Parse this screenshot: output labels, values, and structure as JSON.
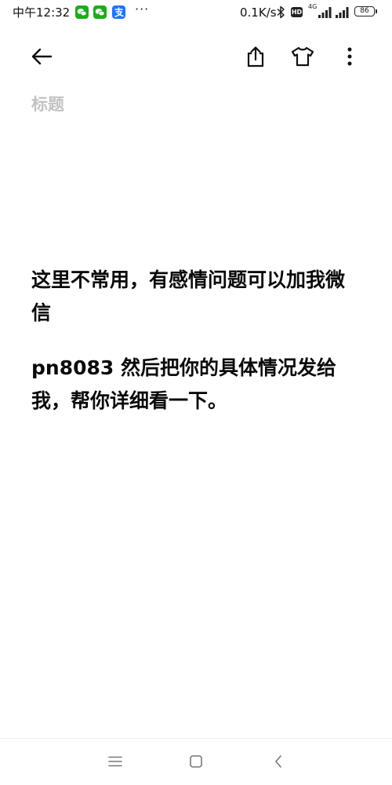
{
  "status_bar": {
    "time": "中午12:32",
    "more_notifications": "···",
    "net_speed": "0.1K/s",
    "hd_label": "HD",
    "network_type": "4G",
    "battery_level": "86"
  },
  "toolbar": {
    "back_icon": "arrow-left-icon",
    "share_icon": "share-icon",
    "theme_icon": "tshirt-icon",
    "more_icon": "more-vertical-icon"
  },
  "note": {
    "title_placeholder": "标题",
    "paragraphs": [
      "这里不常用，有感情问题可以加我微信",
      "pn8083 然后把你的具体情况发给我，帮你详细看一下。"
    ]
  },
  "nav_bar": {
    "menu_icon": "menu-icon",
    "home_icon": "square-home-icon",
    "back_icon": "chevron-left-icon"
  },
  "colors": {
    "wechat_green": "#1aad19",
    "alipay_blue": "#1677ff",
    "title_placeholder_gray": "#c2c2c2"
  }
}
